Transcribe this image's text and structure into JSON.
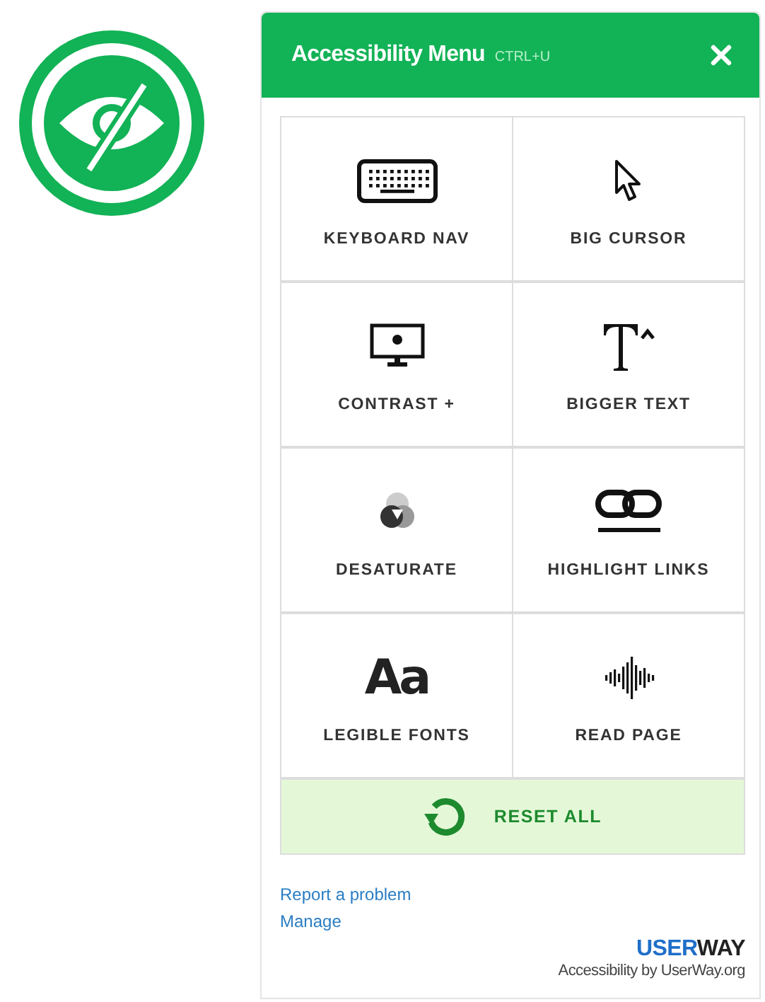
{
  "badge": {
    "kind": "hidden-eye"
  },
  "header": {
    "title": "Accessibility Menu",
    "shortcut": "CTRL+U"
  },
  "tiles": [
    {
      "kind": "keyboard",
      "label": "KEYBOARD NAV"
    },
    {
      "kind": "cursor",
      "label": "BIG CURSOR"
    },
    {
      "kind": "contrast",
      "label": "CONTRAST +"
    },
    {
      "kind": "text-size",
      "label": "BIGGER TEXT"
    },
    {
      "kind": "desaturate",
      "label": "DESATURATE"
    },
    {
      "kind": "link",
      "label": "HIGHLIGHT LINKS"
    },
    {
      "kind": "font",
      "glyph": "Aa",
      "label": "LEGIBLE FONTS"
    },
    {
      "kind": "audio",
      "label": "READ PAGE"
    }
  ],
  "reset": {
    "label": "RESET ALL"
  },
  "links": [
    "Report a problem",
    "Manage"
  ],
  "brand": {
    "primary": "USER",
    "secondary": "WAY",
    "tagline": "Accessibility by UserWay.org"
  }
}
